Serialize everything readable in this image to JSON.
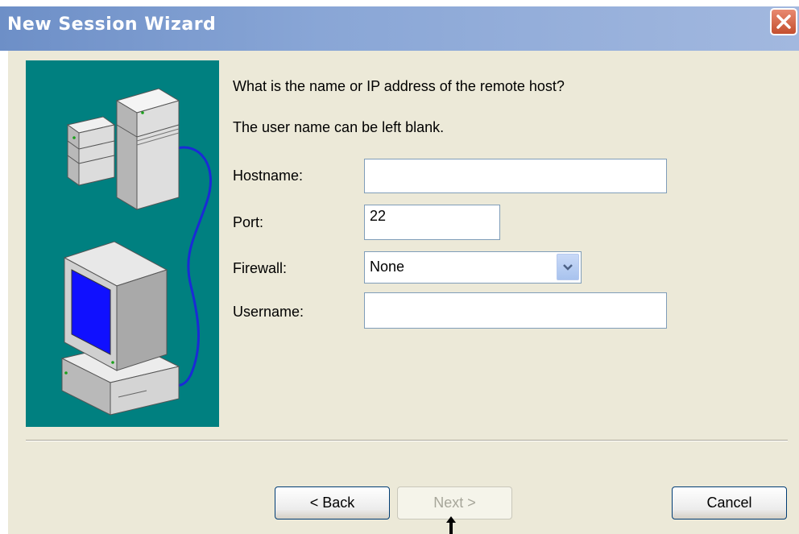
{
  "window": {
    "title": "New Session Wizard"
  },
  "prompt": {
    "line1": "What is the name or IP address of the remote host?",
    "line2": "The user name can be left blank."
  },
  "form": {
    "hostname": {
      "label": "Hostname:",
      "value": ""
    },
    "port": {
      "label": "Port:",
      "value": "22"
    },
    "firewall": {
      "label": "Firewall:",
      "value": "None"
    },
    "username": {
      "label": "Username:",
      "value": ""
    }
  },
  "buttons": {
    "back": "< Back",
    "next": "Next >",
    "cancel": "Cancel"
  },
  "colors": {
    "titlebar": "#89a6d6",
    "dialog_bg": "#ece9d8",
    "illustration_bg": "#008080",
    "cable": "#1a2bd6",
    "screen": "#1010ff"
  },
  "icons": [
    "close-icon",
    "server-tower-icon",
    "computer-icon",
    "dropdown-arrow-icon",
    "mouse-pointer-arrow-icon"
  ]
}
